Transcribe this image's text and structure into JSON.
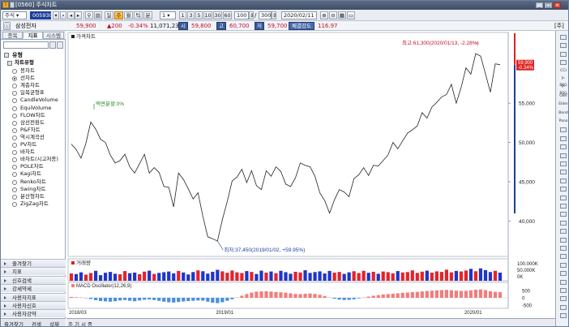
{
  "window": {
    "title": "[0560] 주식차트",
    "logo_text": "1"
  },
  "toolbar": {
    "market_select": "주식",
    "code_value": "005930",
    "period_buttons": [
      "일",
      "주",
      "월",
      "틱",
      "분"
    ],
    "active_period": "주",
    "interval_value": "1",
    "interval_options": [
      "1",
      "3",
      "5",
      "10",
      "30",
      "60"
    ],
    "zoom_value": "100",
    "count_value": "300",
    "date_value": "2020/02/11"
  },
  "quote": {
    "name": "삼성전자",
    "price": "59,900",
    "change": "▲200",
    "change_pct": "-0.34%",
    "volume": "11,071,231",
    "label_open": "시",
    "open": "59,800",
    "label_high": "고",
    "high": "60,700",
    "label_low": "저",
    "low": "59,700",
    "strength_label": "체결강도",
    "strength": "116.97",
    "unit_badge": "[주]"
  },
  "left_panel": {
    "tabs": [
      "종목",
      "지표",
      "시스템"
    ],
    "active_tab": "지표",
    "section_title": "유형",
    "subsection_title": "차트유형",
    "chart_types": [
      "봉차트",
      "선차트",
      "계층차트",
      "일목균형표",
      "CandleVolume",
      "EquiVolume",
      "FLOW차트",
      "삼선전환도",
      "P&F차트",
      "역시계곡선",
      "PV차트",
      "바차트",
      "바차트(시고저종)",
      "POLE차트",
      "Kagi차트",
      "Renko차트",
      "Swing차트",
      "분산형차트",
      "ZigZag차트"
    ],
    "selected_type": "선차트",
    "bottom_items": [
      "즐겨찾기",
      "지표",
      "신호검색",
      "강세약세",
      "사용자지표",
      "사용자신호",
      "사용자강약"
    ],
    "footer_tabs": [
      "즐겨찾기",
      "검색",
      "삭제"
    ]
  },
  "panes": {
    "price_title": "가격차트",
    "volume_title": "거래량",
    "macd_title": "MACD Oscillator(12,26,9)",
    "price_axis": [
      "55,000",
      "50,000",
      "45,000",
      "40,000"
    ],
    "volume_axis": [
      "100.000K",
      "50.000K",
      "0K"
    ],
    "macd_axis": [
      "500",
      "0",
      "-500"
    ],
    "x_axis": [
      "2018/03",
      "2019/01",
      "2020/01"
    ],
    "annotations": {
      "split_note": "액면분할:0%",
      "high_note": "최고:61,300(2020/01/13, -2.28%)",
      "low_note": "최저:37,450(2019/01/02, +59.95%)"
    },
    "last_price_box": "59,900",
    "last_change_box": "-0.34%"
  },
  "right_toolbar": {
    "labels": [
      "CCI",
      "P-BSG",
      "P-BSG",
      "OBV",
      "Elder",
      "Band",
      "Pano"
    ]
  },
  "bottom_bar": {
    "labels": [
      "주",
      "기",
      "시",
      "종"
    ]
  },
  "chart_data": {
    "type": "line",
    "x_axis_labels": [
      "2018/03",
      "2019/01",
      "2020/01"
    ],
    "price_axis_ticks": [
      55000,
      50000,
      45000,
      40000
    ],
    "volume_axis_ticks": [
      "100.000K",
      "50.000K",
      "0K"
    ],
    "macd_axis_ticks": [
      500,
      0,
      -500
    ],
    "price": [
      49800,
      49100,
      48000,
      49900,
      52600,
      51700,
      50400,
      50000,
      48400,
      47400,
      47700,
      48500,
      46900,
      46100,
      47300,
      48500,
      46100,
      46800,
      46200,
      44400,
      44300,
      41800,
      46100,
      45300,
      44100,
      42800,
      43600,
      40600,
      38000,
      37750,
      37450,
      40200,
      42500,
      45100,
      45600,
      46600,
      44900,
      46400,
      44500,
      44000,
      46400,
      45700,
      46900,
      46300,
      44700,
      44400,
      45500,
      47400,
      47100,
      46900,
      45700,
      43600,
      42600,
      41000,
      42700,
      44000,
      43700,
      43100,
      45400,
      45900,
      46800,
      45800,
      47100,
      47000,
      47700,
      48400,
      50000,
      49200,
      50200,
      51200,
      51600,
      52100,
      53800,
      53100,
      54500,
      55100,
      55800,
      56100,
      57400,
      55000,
      57000,
      59500,
      58700,
      61300,
      61000,
      58700,
      56400,
      60000,
      59900
    ],
    "volume": [
      52,
      48,
      60,
      44,
      55,
      71,
      40,
      57,
      63,
      50,
      46,
      69,
      54,
      58,
      47,
      65,
      72,
      49,
      56,
      61,
      66,
      53,
      70,
      59,
      45,
      62,
      74,
      68,
      51,
      64,
      78,
      67,
      57,
      73,
      60,
      55,
      69,
      63,
      48,
      72,
      58,
      66,
      54,
      71,
      61,
      50,
      64,
      59,
      75,
      56,
      62,
      67,
      52,
      70,
      58,
      63,
      49,
      60,
      68,
      55,
      71,
      57,
      64,
      50,
      66,
      61,
      53,
      69,
      59,
      62,
      74,
      56,
      65,
      72,
      58,
      67,
      63,
      79,
      60,
      70,
      66,
      73,
      85,
      68,
      88,
      76,
      62,
      71,
      58
    ],
    "macd": [
      60,
      40,
      20,
      -20,
      -80,
      -160,
      -220,
      -240,
      -260,
      -230,
      -180,
      -150,
      -200,
      -230,
      -180,
      -130,
      -110,
      -150,
      -200,
      -260,
      -300,
      -320,
      -280,
      -250,
      -220,
      -200,
      -180,
      -190,
      -260,
      -330,
      -360,
      -300,
      -200,
      -100,
      20,
      140,
      250,
      350,
      410,
      430,
      440,
      420,
      390,
      370,
      340,
      300,
      260,
      250,
      270,
      290,
      260,
      200,
      120,
      20,
      -60,
      -120,
      -150,
      -140,
      -100,
      -40,
      20,
      80,
      140,
      180,
      220,
      250,
      280,
      300,
      330,
      350,
      380,
      400,
      430,
      460,
      480,
      500,
      520,
      530,
      510,
      480,
      460,
      470,
      500,
      540,
      560,
      520,
      440,
      400,
      380
    ]
  }
}
